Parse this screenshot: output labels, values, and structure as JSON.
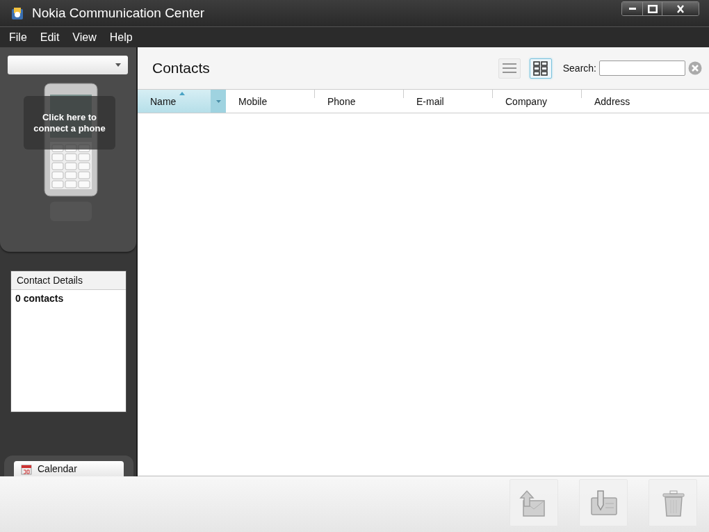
{
  "window": {
    "title": "Nokia Communication Center"
  },
  "menu": [
    {
      "label": "File"
    },
    {
      "label": "Edit"
    },
    {
      "label": "View"
    },
    {
      "label": "Help"
    }
  ],
  "sidebar": {
    "device_prompt": "Click here to connect a phone",
    "contact_details": {
      "title": "Contact Details",
      "summary": "0 contacts"
    },
    "nav_items": [
      {
        "label": "Calendar",
        "kind": "calendar"
      }
    ]
  },
  "contacts": {
    "title": "Contacts",
    "views": [
      {
        "kind": "list",
        "selected": false
      },
      {
        "kind": "grid",
        "selected": true
      }
    ],
    "search": {
      "label": "Search:"
    },
    "columns": [
      {
        "label": "Name",
        "sorted": true
      },
      {
        "label": "Mobile",
        "sorted": false
      },
      {
        "label": "Phone",
        "sorted": false
      },
      {
        "label": "E-mail",
        "sorted": false
      },
      {
        "label": "Company",
        "sorted": false
      },
      {
        "label": "Address",
        "sorted": false
      }
    ]
  },
  "actions": [
    {
      "kind": "send",
      "disabled": true
    },
    {
      "kind": "edit",
      "disabled": true
    },
    {
      "kind": "delete",
      "disabled": true
    }
  ]
}
